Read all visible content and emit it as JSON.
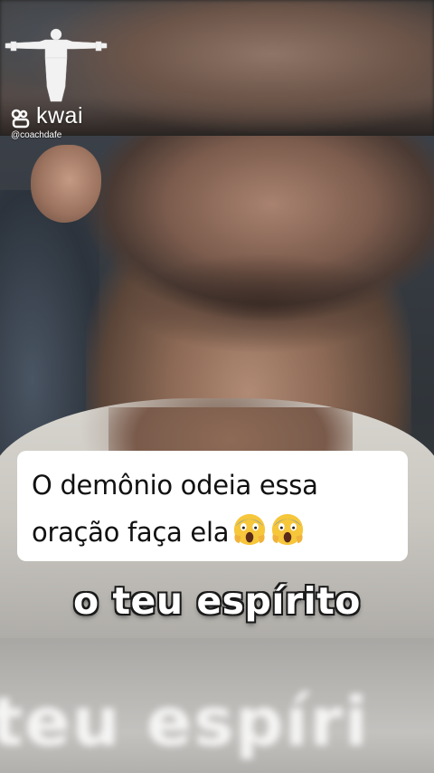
{
  "watermark": {
    "brand": "kwai",
    "handle": "@coachdafe",
    "statue_icon": "christ-statue-icon",
    "logo_icon": "kwai-logo-icon"
  },
  "caption": {
    "line1": "O demônio odeia essa",
    "line2": "oração faça ela",
    "emoji": "face-screaming-in-fear-icon"
  },
  "subtitle": "o teu espírito",
  "blurred_subtitle": "teu espíri",
  "colors": {
    "caption_bg": "#ffffff",
    "caption_text": "#111111",
    "subtitle_text": "#ffffff",
    "emoji_face": "#f6c63b"
  }
}
